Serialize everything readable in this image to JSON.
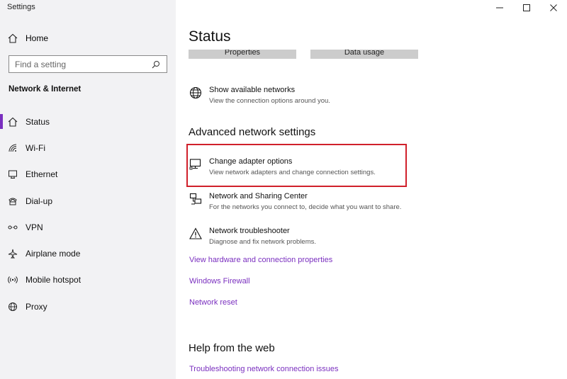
{
  "window": {
    "title": "Settings",
    "controls": {
      "minimize": "—",
      "maximize": "☐",
      "close": "✕"
    }
  },
  "sidebar": {
    "home_label": "Home",
    "search_placeholder": "Find a setting",
    "section_heading": "Network & Internet",
    "items": [
      {
        "label": "Status",
        "icon": "home-status-icon",
        "active": true
      },
      {
        "label": "Wi-Fi",
        "icon": "wifi-icon"
      },
      {
        "label": "Ethernet",
        "icon": "ethernet-icon"
      },
      {
        "label": "Dial-up",
        "icon": "dialup-icon"
      },
      {
        "label": "VPN",
        "icon": "vpn-icon"
      },
      {
        "label": "Airplane mode",
        "icon": "airplane-icon"
      },
      {
        "label": "Mobile hotspot",
        "icon": "hotspot-icon"
      },
      {
        "label": "Proxy",
        "icon": "globe-icon"
      }
    ]
  },
  "main": {
    "title": "Status",
    "top_buttons": [
      "Properties",
      "Data usage"
    ],
    "show_networks": {
      "title": "Show available networks",
      "desc": "View the connection options around you."
    },
    "advanced_heading": "Advanced network settings",
    "advanced_options": [
      {
        "title": "Change adapter options",
        "desc": "View network adapters and change connection settings.",
        "icon": "monitor-icon"
      },
      {
        "title": "Network and Sharing Center",
        "desc": "For the networks you connect to, decide what you want to share.",
        "icon": "sharing-center-icon"
      },
      {
        "title": "Network troubleshooter",
        "desc": "Diagnose and fix network problems.",
        "icon": "warning-icon"
      }
    ],
    "links": [
      "View hardware and connection properties",
      "Windows Firewall",
      "Network reset"
    ],
    "help_heading": "Help from the web",
    "help_links": [
      "Troubleshooting network connection issues"
    ]
  },
  "colors": {
    "accent": "#7a2fbf",
    "highlight": "#d0202b",
    "sidebar_bg": "#f2f2f4"
  }
}
